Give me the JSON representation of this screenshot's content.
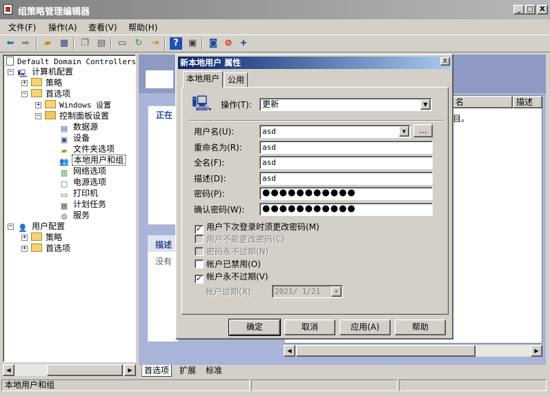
{
  "window": {
    "title": "组策略管理编辑器",
    "controls": [
      "_",
      "□",
      "X"
    ]
  },
  "menu": [
    "文件(F)",
    "操作(A)",
    "查看(V)",
    "帮助(H)"
  ],
  "toolbar": {
    "icons": [
      "back-arrow-icon",
      "forward-arrow-icon",
      "up-folder-icon",
      "show-tree-icon",
      "copy-icon",
      "paste-icon",
      "print-icon",
      "refresh-icon",
      "export-icon",
      "help-icon",
      "properties-icon",
      "new-item-icon",
      "stop-icon",
      "add-icon"
    ]
  },
  "tree": {
    "root": "Default Domain Controllers P",
    "computer_config": "计算机配置",
    "policies": "策略",
    "preferences": "首选项",
    "windows_settings": "Windows 设置",
    "control_panel": "控制面板设置",
    "items": [
      "数据源",
      "设备",
      "文件夹选项",
      "本地用户和组",
      "网络选项",
      "电源选项",
      "打印机",
      "计划任务",
      "服务"
    ],
    "user_config": "用户配置",
    "user_policies": "策略",
    "user_preferences": "首选项"
  },
  "right_pane": {
    "processing_partial": "正在",
    "description_partial": "描述",
    "none_partial": "没有",
    "col_name": "名",
    "col_desc": "描述",
    "row_text": "目。"
  },
  "bottom_tabs": [
    "首选项",
    "扩展",
    "标准"
  ],
  "status": {
    "text": "本地用户和组"
  },
  "dialog": {
    "title": "新本地用户 属性",
    "close": "X",
    "tabs": [
      "本地用户",
      "公用"
    ],
    "action_label": "操作(T):",
    "action_value": "更新",
    "username_label": "用户名(U):",
    "username_value": "asd",
    "browse_label": "...",
    "rename_label": "重命名为(R):",
    "rename_value": "asd",
    "fullname_label": "全名(F):",
    "fullname_value": "asd",
    "desc_label": "描述(D):",
    "desc_value": "asd",
    "password_label": "密码(P):",
    "password_value": "●●●●●●●●●●●",
    "confirm_label": "确认密码(W):",
    "confirm_value": "●●●●●●●●●●●",
    "checkboxes": [
      {
        "label": "用户下次登录时须更改密码(M)",
        "checked": true,
        "enabled": true
      },
      {
        "label": "用户不能更改密码(C)",
        "checked": false,
        "enabled": false
      },
      {
        "label": "密码永不过期(N)",
        "checked": false,
        "enabled": false
      },
      {
        "label": "帐户已禁用(O)",
        "checked": false,
        "enabled": true
      },
      {
        "label": "帐户永不过期(V)",
        "checked": true,
        "enabled": true
      }
    ],
    "expire_label": "帐户过期(X):",
    "expire_value": "2021/ 1/21",
    "buttons": {
      "ok": "确定",
      "cancel": "取消",
      "apply": "应用(A)",
      "help": "帮助"
    }
  }
}
